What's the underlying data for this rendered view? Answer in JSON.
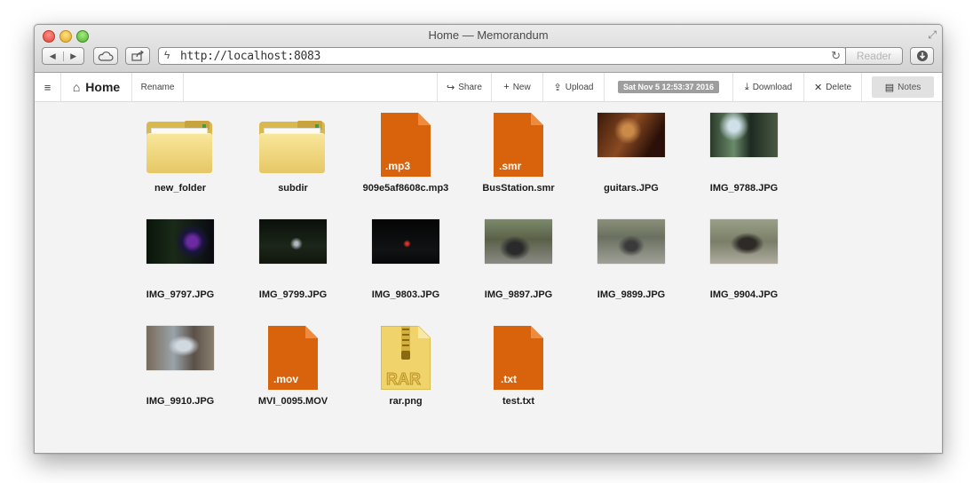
{
  "window": {
    "title": "Home — Memorandum",
    "url": "http://localhost:8083",
    "reader_label": "Reader"
  },
  "toolbar": {
    "menu_icon": "hamburger-icon",
    "home_label": "Home",
    "rename_label": "Rename",
    "share_label": "Share",
    "new_label": "New",
    "upload_label": "Upload",
    "date_badge": "Sat Nov 5 12:53:37 2016",
    "download_label": "Download",
    "delete_label": "Delete",
    "notes_label": "Notes"
  },
  "colors": {
    "file_orange": "#d9620c",
    "folder_yellow": "#f2d97f",
    "badge_gray": "#9e9e9e"
  },
  "files": [
    {
      "name": "new_folder",
      "kind": "folder"
    },
    {
      "name": "subdir",
      "kind": "folder"
    },
    {
      "name": "909e5af8608c.mp3",
      "kind": "file",
      "ext": ".mp3"
    },
    {
      "name": "BusStation.smr",
      "kind": "file",
      "ext": ".smr"
    },
    {
      "name": "guitars.JPG",
      "kind": "photo"
    },
    {
      "name": "IMG_9788.JPG",
      "kind": "photo"
    },
    {
      "name": "IMG_9797.JPG",
      "kind": "photo"
    },
    {
      "name": "IMG_9799.JPG",
      "kind": "photo"
    },
    {
      "name": "IMG_9803.JPG",
      "kind": "photo"
    },
    {
      "name": "IMG_9897.JPG",
      "kind": "photo"
    },
    {
      "name": "IMG_9899.JPG",
      "kind": "photo"
    },
    {
      "name": "IMG_9904.JPG",
      "kind": "photo"
    },
    {
      "name": "IMG_9910.JPG",
      "kind": "photo"
    },
    {
      "name": "MVI_0095.MOV",
      "kind": "file",
      "ext": ".mov"
    },
    {
      "name": "rar.png",
      "kind": "rar",
      "label": "RAR"
    },
    {
      "name": "test.txt",
      "kind": "file",
      "ext": ".txt"
    }
  ]
}
